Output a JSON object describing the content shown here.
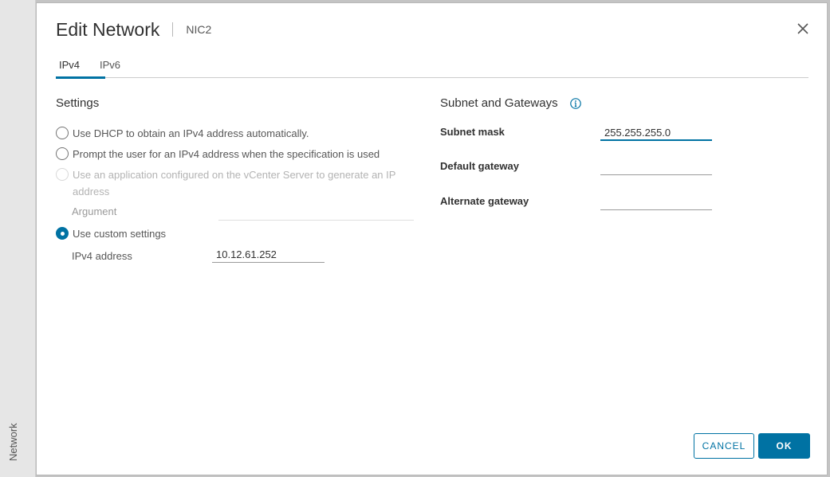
{
  "side_panel": {
    "label": "Network"
  },
  "dialog": {
    "title": "Edit Network",
    "subtitle": "NIC2"
  },
  "tabs": [
    {
      "label": "IPv4",
      "active": true
    },
    {
      "label": "IPv6",
      "active": false
    }
  ],
  "settings": {
    "title": "Settings",
    "options": {
      "dhcp": {
        "label": "Use DHCP to obtain an IPv4 address automatically.",
        "checked": false,
        "enabled": true
      },
      "prompt": {
        "label": "Prompt the user for an IPv4 address when the specification is used",
        "checked": false,
        "enabled": true
      },
      "vcenter_app": {
        "label": "Use an application configured on the vCenter Server to generate an IP address",
        "checked": false,
        "enabled": false
      },
      "custom": {
        "label": "Use custom settings",
        "checked": true,
        "enabled": true
      }
    },
    "argument": {
      "label": "Argument",
      "value": ""
    },
    "ipv4_address": {
      "label": "IPv4 address",
      "value": "10.12.61.252"
    }
  },
  "subnet": {
    "title": "Subnet and Gateways",
    "subnet_mask": {
      "label": "Subnet mask",
      "value": "255.255.255.0"
    },
    "default_gateway": {
      "label": "Default gateway",
      "value": ""
    },
    "alternate_gateway": {
      "label": "Alternate gateway",
      "value": ""
    }
  },
  "buttons": {
    "cancel": "CANCEL",
    "ok": "OK"
  },
  "colors": {
    "accent": "#0072a3",
    "background": "#ffffff",
    "side_panel": "#e6e6e6"
  },
  "icons": {
    "close": "close-icon",
    "info": "info-icon"
  }
}
